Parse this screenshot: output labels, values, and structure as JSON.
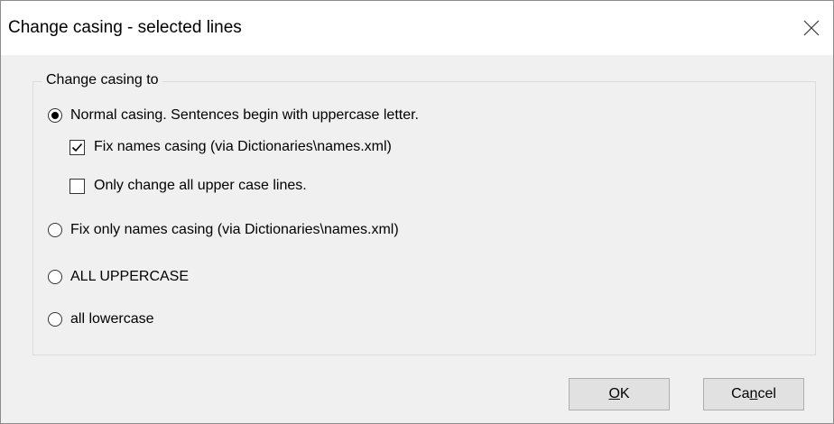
{
  "window": {
    "title": "Change casing - selected lines",
    "close_icon": "close-icon"
  },
  "group": {
    "legend": "Change casing to"
  },
  "options": {
    "normal": {
      "label": "Normal casing. Sentences begin with uppercase letter.",
      "checked": true
    },
    "fix_names": {
      "label": "Fix names casing (via Dictionaries\\names.xml)",
      "checked": true
    },
    "only_upper": {
      "label": "Only change all upper case lines.",
      "checked": false
    },
    "fix_only_names": {
      "label": "Fix only names casing (via Dictionaries\\names.xml)",
      "checked": false
    },
    "all_upper": {
      "label": "ALL UPPERCASE",
      "checked": false
    },
    "all_lower": {
      "label": "all lowercase",
      "checked": false
    }
  },
  "buttons": {
    "ok": {
      "mnemonic": "O",
      "rest": "K"
    },
    "cancel": {
      "pre": "Ca",
      "mnemonic": "n",
      "rest": "cel"
    }
  }
}
